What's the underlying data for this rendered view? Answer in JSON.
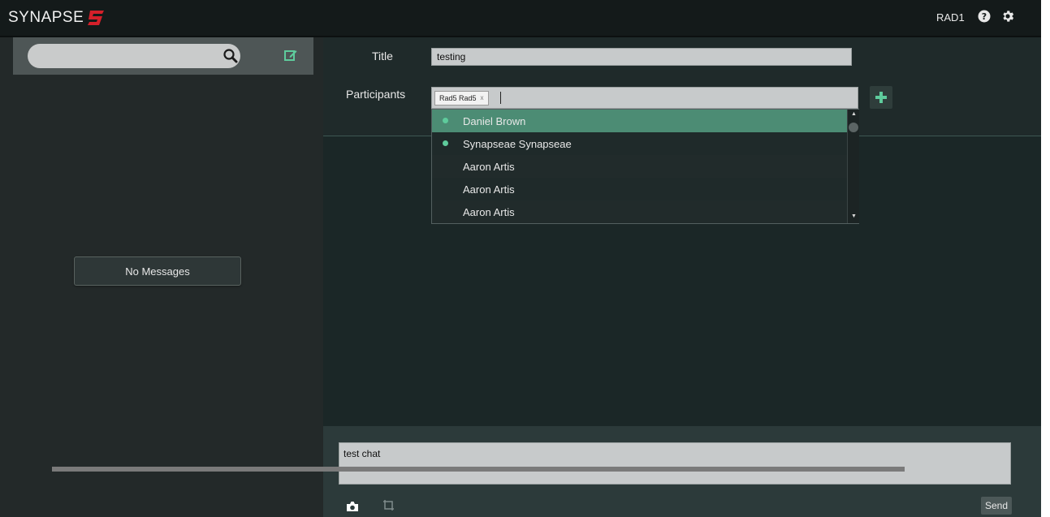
{
  "topbar": {
    "logo_text": "SYNAPSE",
    "user": "RAD1",
    "icons": [
      "help-icon",
      "gear-icon"
    ]
  },
  "sidebar": {
    "search_placeholder": "",
    "search_value": "",
    "empty_label": "No Messages",
    "icons": [
      "search-icon",
      "compose-icon"
    ]
  },
  "form": {
    "title_label": "Title",
    "title_value": "testing",
    "participants_label": "Participants",
    "participants": [
      {
        "name": "Rad5 Rad5",
        "remove": "x"
      }
    ],
    "add_icon": "plus-icon"
  },
  "dropdown": {
    "options": [
      {
        "name": "Daniel Brown",
        "online": true,
        "selected": true
      },
      {
        "name": "Synapseae Synapseae",
        "online": true,
        "selected": false
      },
      {
        "name": "Aaron Artis",
        "online": false,
        "selected": false
      },
      {
        "name": "Aaron Artis",
        "online": false,
        "selected": false
      },
      {
        "name": "Aaron Artis",
        "online": false,
        "selected": false
      }
    ]
  },
  "compose": {
    "message_value": "test chat",
    "send_label": "Send",
    "icons": [
      "camera-icon",
      "crop-icon"
    ]
  },
  "colors": {
    "accent": "#d4202a",
    "selected": "#4c8c74",
    "online_dot": "#5ecb9c",
    "add_plus": "#5ecb9c"
  }
}
